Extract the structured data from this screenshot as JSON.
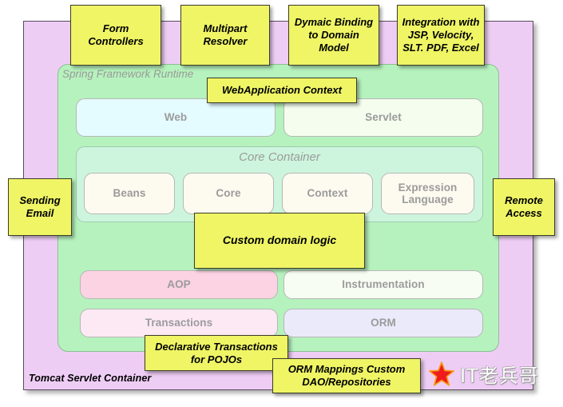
{
  "diagram": {
    "title": "Spring Framework Runtime architecture",
    "colors": {
      "note_fill": "#eff565",
      "note_border": "#3c3c28",
      "tomcat_fill": "#eecdf5",
      "runtime_fill": "#b6f2bd",
      "core_container_fill": "#cdf5dd",
      "web_fill": "#e4fbff",
      "servlet_fill": "#f4fdee",
      "module_neutral_fill": "#fdfaef",
      "aop_fill": "#fbd3e3",
      "transactions_fill": "#fce9f3",
      "instrumentation_fill": "#f7fdf3",
      "orm_fill": "#eaeafb",
      "label_text": "#9b9b9b",
      "star": "#ee1c1c",
      "star_outline": "#f79c18"
    }
  },
  "tomcat": {
    "label": "Tomcat Servlet Container"
  },
  "runtime": {
    "label": "Spring Framework Runtime"
  },
  "web_layer": [
    {
      "label": "Web"
    },
    {
      "label": "Servlet"
    }
  ],
  "core_container": {
    "label": "Core Container",
    "modules": [
      {
        "label": "Beans"
      },
      {
        "label": "Core"
      },
      {
        "label": "Context"
      },
      {
        "label": "Expression Language"
      }
    ]
  },
  "aop_layer": [
    {
      "label": "AOP"
    },
    {
      "label": "Instrumentation"
    }
  ],
  "data_layer": [
    {
      "label": "Transactions"
    },
    {
      "label": "ORM"
    }
  ],
  "notes": {
    "form_controllers": "Form Controllers",
    "multipart_resolver": "Multipart Resolver",
    "dynamic_binding": "Dymaic Binding to Domain Model",
    "integration": "Integration with JSP, Velocity, SLT. PDF, Excel",
    "webapplication_context": "WebApplication Context",
    "sending_email": "Sending Email",
    "remote_access": "Remote Access",
    "custom_domain_logic": "Custom domain logic",
    "declarative_transactions": "Declarative Transactions for POJOs",
    "orm_mappings": "ORM Mappings Custom DAO/Repositories"
  },
  "watermark": {
    "icon": "star-icon",
    "text": "IT老兵哥"
  }
}
